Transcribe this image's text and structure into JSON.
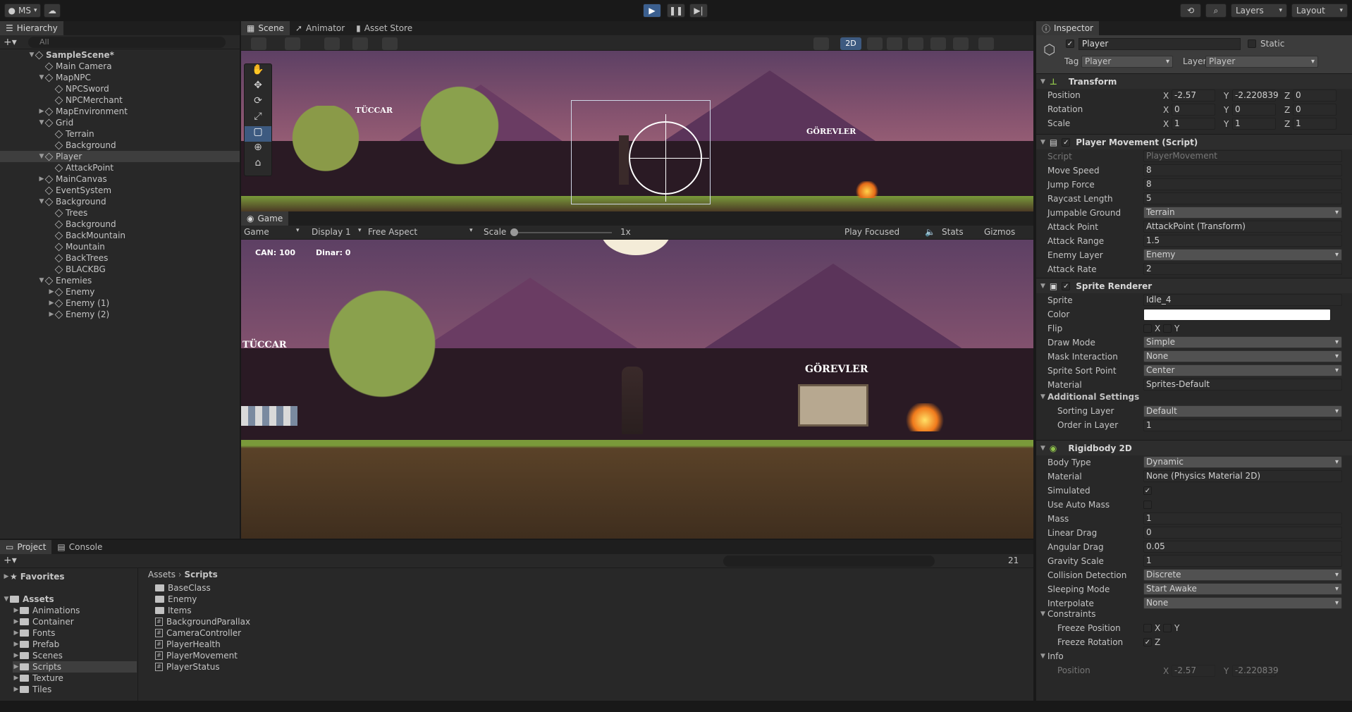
{
  "toolbar": {
    "account": "MS",
    "layers": "Layers",
    "layout": "Layout"
  },
  "hierarchy": {
    "title": "Hierarchy",
    "search_placeholder": "All",
    "rows": [
      {
        "label": "SampleScene*",
        "depth": 0,
        "arrow": "▼",
        "bold": true
      },
      {
        "label": "Main Camera",
        "depth": 1,
        "arrow": ""
      },
      {
        "label": "MapNPC",
        "depth": 1,
        "arrow": "▼"
      },
      {
        "label": "NPCSword",
        "depth": 2,
        "arrow": ""
      },
      {
        "label": "NPCMerchant",
        "depth": 2,
        "arrow": ""
      },
      {
        "label": "MapEnvironment",
        "depth": 1,
        "arrow": "▶"
      },
      {
        "label": "Grid",
        "depth": 1,
        "arrow": "▼"
      },
      {
        "label": "Terrain",
        "depth": 2,
        "arrow": ""
      },
      {
        "label": "Background",
        "depth": 2,
        "arrow": ""
      },
      {
        "label": "Player",
        "depth": 1,
        "arrow": "▼",
        "selected": true
      },
      {
        "label": "AttackPoint",
        "depth": 2,
        "arrow": ""
      },
      {
        "label": "MainCanvas",
        "depth": 1,
        "arrow": "▶"
      },
      {
        "label": "EventSystem",
        "depth": 1,
        "arrow": ""
      },
      {
        "label": "Background",
        "depth": 1,
        "arrow": "▼"
      },
      {
        "label": "Trees",
        "depth": 2,
        "arrow": ""
      },
      {
        "label": "Background",
        "depth": 2,
        "arrow": ""
      },
      {
        "label": "BackMountain",
        "depth": 2,
        "arrow": ""
      },
      {
        "label": "Mountain",
        "depth": 2,
        "arrow": ""
      },
      {
        "label": "BackTrees",
        "depth": 2,
        "arrow": ""
      },
      {
        "label": "BLACKBG",
        "depth": 2,
        "arrow": ""
      },
      {
        "label": "Enemies",
        "depth": 1,
        "arrow": "▼"
      },
      {
        "label": "Enemy",
        "depth": 2,
        "arrow": "▶"
      },
      {
        "label": "Enemy (1)",
        "depth": 2,
        "arrow": "▶"
      },
      {
        "label": "Enemy (2)",
        "depth": 2,
        "arrow": "▶"
      }
    ]
  },
  "scene": {
    "tabs": [
      "Scene",
      "Animator",
      "Asset Store"
    ],
    "mode_2d": "2D",
    "sign_left": "TÜCCAR",
    "sign_right": "GÖREVLER"
  },
  "game": {
    "tab": "Game",
    "display_mode": "Game",
    "display": "Display 1",
    "aspect": "Free Aspect",
    "scale_label": "Scale",
    "scale_value": "1x",
    "play_focused": "Play Focused",
    "stats": "Stats",
    "gizmos": "Gizmos",
    "hud_can": "CAN: 100",
    "hud_dinar": "Dinar: 0"
  },
  "inspector": {
    "title": "Inspector",
    "object_name": "Player",
    "static_label": "Static",
    "tag_label": "Tag",
    "tag_value": "Player",
    "layer_label": "Layer",
    "layer_value": "Player",
    "transform": {
      "title": "Transform",
      "position_label": "Position",
      "px": "-2.57",
      "py": "-2.220839",
      "pz": "0",
      "rotation_label": "Rotation",
      "rx": "0",
      "ry": "0",
      "rz": "0",
      "scale_label": "Scale",
      "sx": "1",
      "sy": "1",
      "sz": "1"
    },
    "movement": {
      "title": "Player Movement (Script)",
      "rows": [
        {
          "label": "Script",
          "value": "PlayerMovement",
          "kind": "ref",
          "dim": true
        },
        {
          "label": "Move Speed",
          "value": "8",
          "kind": "field"
        },
        {
          "label": "Jump Force",
          "value": "8",
          "kind": "field"
        },
        {
          "label": "Raycast Length",
          "value": "5",
          "kind": "field"
        },
        {
          "label": "Jumpable Ground",
          "value": "Terrain",
          "kind": "drop"
        },
        {
          "label": "Attack Point",
          "value": "AttackPoint (Transform)",
          "kind": "ref"
        },
        {
          "label": "Attack Range",
          "value": "1.5",
          "kind": "field"
        },
        {
          "label": "Enemy Layer",
          "value": "Enemy",
          "kind": "drop"
        },
        {
          "label": "Attack Rate",
          "value": "2",
          "kind": "field"
        }
      ]
    },
    "sprite": {
      "title": "Sprite Renderer",
      "rows": [
        {
          "label": "Sprite",
          "value": "Idle_4",
          "kind": "ref"
        },
        {
          "label": "Color",
          "value": "",
          "kind": "color"
        },
        {
          "label": "Flip",
          "value": "",
          "kind": "flip"
        },
        {
          "label": "Draw Mode",
          "value": "Simple",
          "kind": "drop"
        },
        {
          "label": "Mask Interaction",
          "value": "None",
          "kind": "drop"
        },
        {
          "label": "Sprite Sort Point",
          "value": "Center",
          "kind": "drop"
        },
        {
          "label": "Material",
          "value": "Sprites-Default",
          "kind": "ref"
        }
      ],
      "additional": "Additional Settings",
      "sorting_layer_label": "Sorting Layer",
      "sorting_layer": "Default",
      "order_label": "Order in Layer",
      "order": "1"
    },
    "rigidbody": {
      "title": "Rigidbody 2D",
      "rows": [
        {
          "label": "Body Type",
          "value": "Dynamic",
          "kind": "drop"
        },
        {
          "label": "Material",
          "value": "None (Physics Material 2D)",
          "kind": "ref"
        },
        {
          "label": "Simulated",
          "value": "✓",
          "kind": "check"
        },
        {
          "label": "Use Auto Mass",
          "value": "",
          "kind": "check"
        },
        {
          "label": "Mass",
          "value": "1",
          "kind": "field"
        },
        {
          "label": "Linear Drag",
          "value": "0",
          "kind": "field"
        },
        {
          "label": "Angular Drag",
          "value": "0.05",
          "kind": "field"
        },
        {
          "label": "Gravity Scale",
          "value": "1",
          "kind": "field"
        },
        {
          "label": "Collision Detection",
          "value": "Discrete",
          "kind": "drop"
        },
        {
          "label": "Sleeping Mode",
          "value": "Start Awake",
          "kind": "drop"
        },
        {
          "label": "Interpolate",
          "value": "None",
          "kind": "drop"
        }
      ],
      "constraints": "Constraints",
      "freeze_pos": "Freeze Position",
      "freeze_rot": "Freeze Rotation",
      "info": "Info",
      "info_position": "Position",
      "info_px": "-2.57",
      "info_py": "-2.220839"
    }
  },
  "project": {
    "tabs": [
      "Project",
      "Console"
    ],
    "favorites": "Favorites",
    "assets": "Assets",
    "tree": [
      "Animations",
      "Container",
      "Fonts",
      "Prefab",
      "Scenes",
      "Scripts",
      "Texture",
      "Tiles"
    ],
    "breadcrumb_root": "Assets",
    "breadcrumb_leaf": "Scripts",
    "hidden_count": "21",
    "files": [
      {
        "name": "BaseClass",
        "type": "folder"
      },
      {
        "name": "Enemy",
        "type": "folder"
      },
      {
        "name": "Items",
        "type": "folder"
      },
      {
        "name": "BackgroundParallax",
        "type": "script"
      },
      {
        "name": "CameraController",
        "type": "script"
      },
      {
        "name": "PlayerHealth",
        "type": "script"
      },
      {
        "name": "PlayerMovement",
        "type": "script"
      },
      {
        "name": "PlayerStatus",
        "type": "script"
      }
    ]
  }
}
